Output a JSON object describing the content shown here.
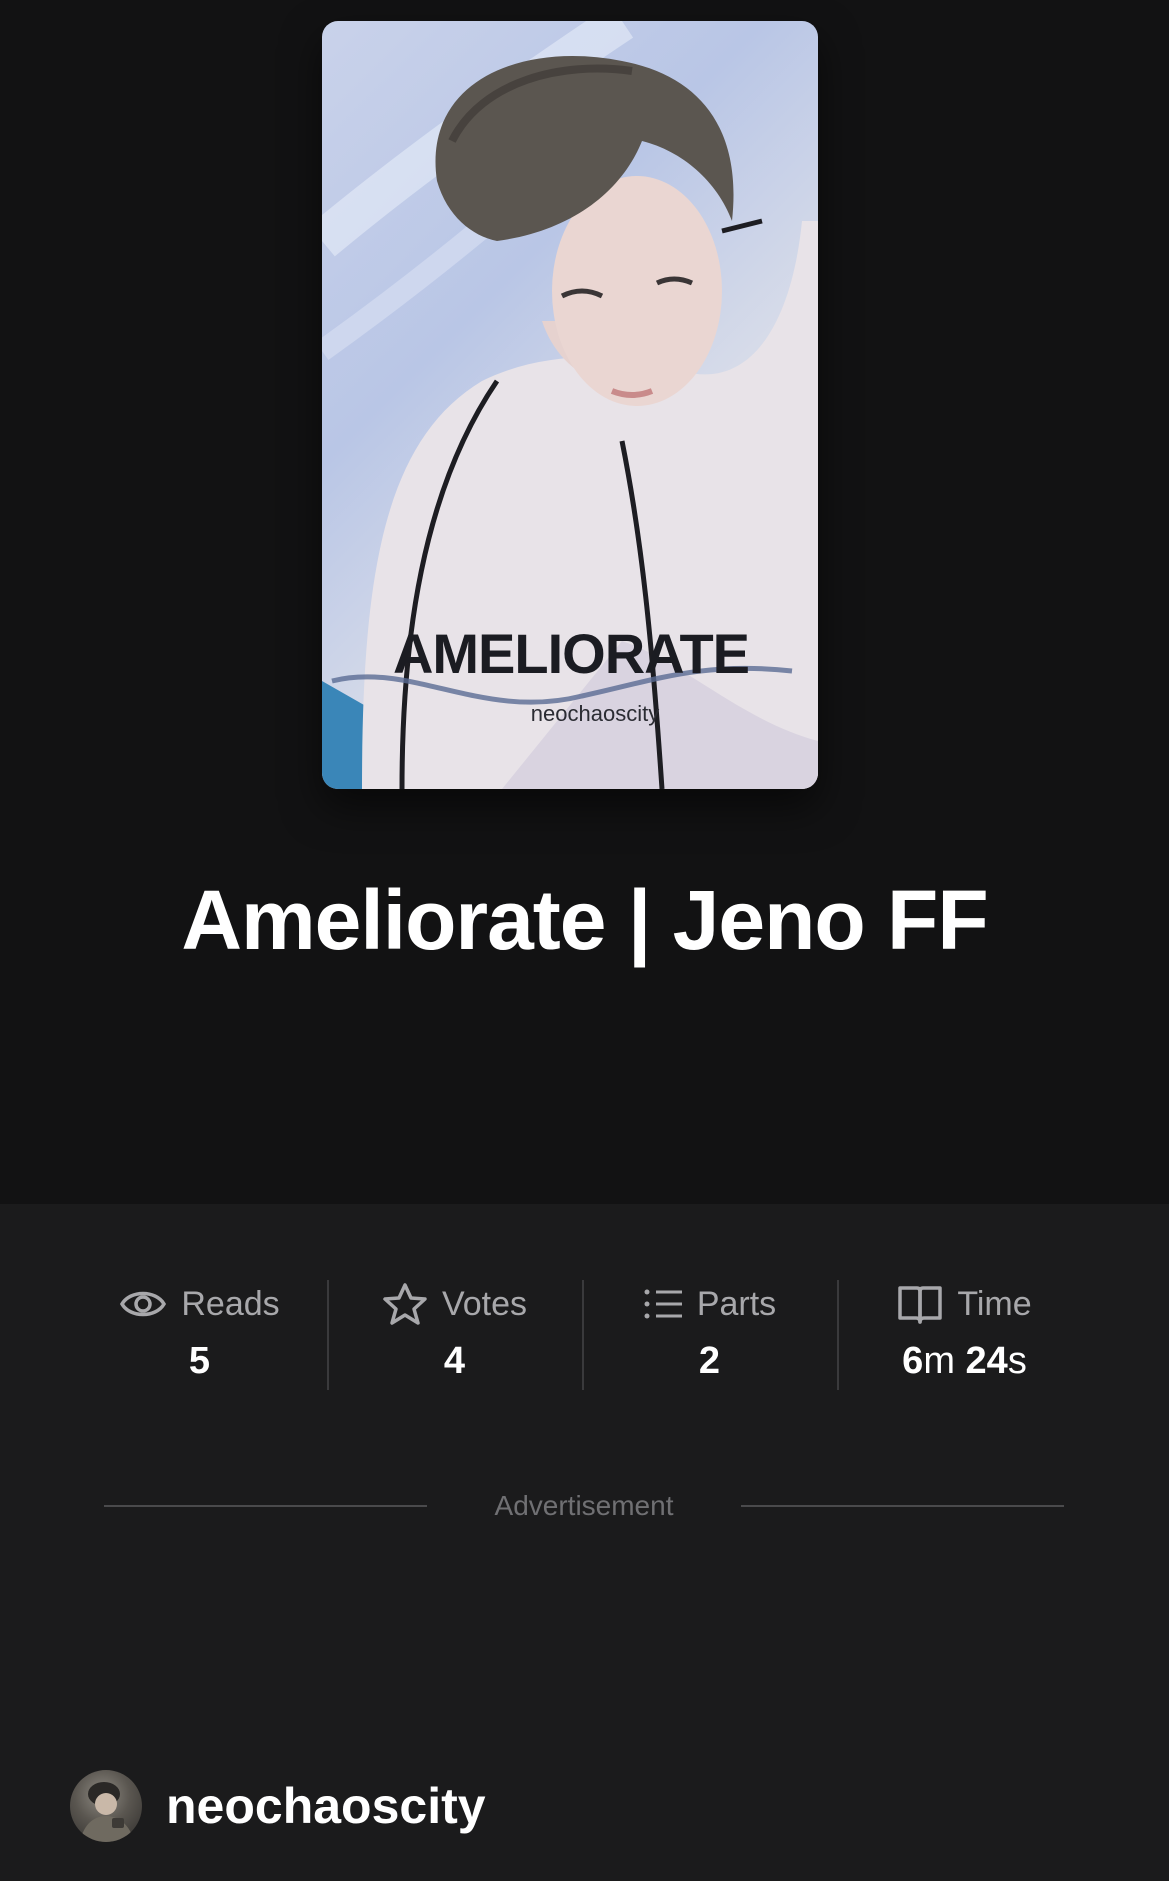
{
  "story": {
    "cover": {
      "title": "AMELIORATE",
      "author": "neochaoscity"
    },
    "title": "Ameliorate | Jeno FF"
  },
  "stats": {
    "reads": {
      "label": "Reads",
      "value": "5",
      "icon": "eye-icon"
    },
    "votes": {
      "label": "Votes",
      "value": "4",
      "icon": "star-icon"
    },
    "parts": {
      "label": "Parts",
      "value": "2",
      "icon": "list-icon"
    },
    "time": {
      "label": "Time",
      "minutes": "6",
      "minutes_unit": "m",
      "seconds": "24",
      "seconds_unit": "s",
      "icon": "book-icon"
    }
  },
  "ad": {
    "label": "Advertisement"
  },
  "author": {
    "username": "neochaoscity"
  },
  "colors": {
    "background_top": "#121213",
    "background_bottom": "#1b1b1c",
    "muted_text": "#a8a8ab",
    "divider": "#3a3a3c"
  }
}
